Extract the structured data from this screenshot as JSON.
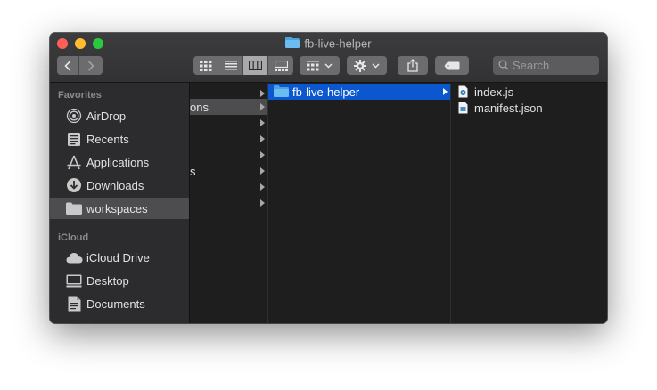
{
  "window": {
    "title": "fb-live-helper"
  },
  "toolbar": {
    "back_icon": "chevron-left-icon",
    "forward_icon": "chevron-right-icon",
    "view_modes": [
      "icon-view",
      "list-view",
      "column-view",
      "gallery-view"
    ],
    "active_view": "column-view",
    "search_placeholder": "Search"
  },
  "sidebar": {
    "favorites_header": "Favorites",
    "favorites": [
      {
        "label": "AirDrop",
        "icon": "airdrop-icon"
      },
      {
        "label": "Recents",
        "icon": "recents-icon"
      },
      {
        "label": "Applications",
        "icon": "applications-icon"
      },
      {
        "label": "Downloads",
        "icon": "downloads-icon"
      },
      {
        "label": "workspaces",
        "icon": "folder-icon",
        "selected": true
      }
    ],
    "icloud_header": "iCloud",
    "icloud": [
      {
        "label": "iCloud Drive",
        "icon": "cloud-icon"
      },
      {
        "label": "Desktop",
        "icon": "desktop-icon"
      },
      {
        "label": "Documents",
        "icon": "documents-icon"
      }
    ]
  },
  "columns": {
    "col1_fragments": [
      "ons",
      "s"
    ],
    "col2": {
      "selected_item": "fb-live-helper"
    },
    "col3": {
      "files": [
        "index.js",
        "manifest.json"
      ]
    }
  },
  "colors": {
    "selection": "#0b57d0",
    "accent_folder": "#4aa3df"
  }
}
